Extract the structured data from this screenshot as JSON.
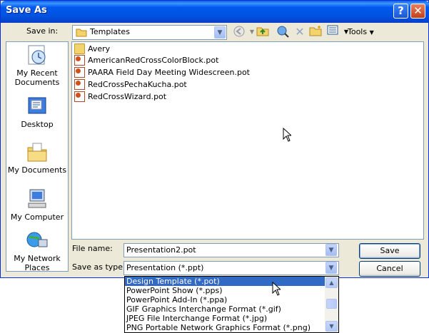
{
  "window": {
    "title": "Save As",
    "help_glyph": "?",
    "close_glyph": "✕"
  },
  "toolbar": {
    "save_in_label": "Save in:",
    "save_in_value": "Templates",
    "tools_label": "Tools",
    "icons": [
      "back-icon",
      "up-folder-icon",
      "search-web-icon",
      "delete-icon",
      "new-folder-icon",
      "views-icon"
    ]
  },
  "places": [
    {
      "id": "recent",
      "label": "My Recent Documents"
    },
    {
      "id": "desktop",
      "label": "Desktop"
    },
    {
      "id": "documents",
      "label": "My Documents"
    },
    {
      "id": "computer",
      "label": "My Computer"
    },
    {
      "id": "network",
      "label": "My Network Places"
    }
  ],
  "files": [
    {
      "name": "Avery",
      "kind": "folder"
    },
    {
      "name": "AmericanRedCrossColorBlock.pot",
      "kind": "pot"
    },
    {
      "name": "PAARA Field Day Meeting Widescreen.pot",
      "kind": "pot"
    },
    {
      "name": "RedCrossPechaKucha.pot",
      "kind": "pot"
    },
    {
      "name": "RedCrossWizard.pot",
      "kind": "pot"
    }
  ],
  "form": {
    "filename_label": "File name:",
    "filename_value": "Presentation2.pot",
    "savetype_label": "Save as type:",
    "savetype_value": "Presentation (*.ppt)",
    "save_button": "Save",
    "cancel_button": "Cancel"
  },
  "type_options": [
    {
      "label": "Design Template (*.pot)",
      "selected": true
    },
    {
      "label": "PowerPoint Show (*.pps)",
      "selected": false
    },
    {
      "label": "PowerPoint Add-In (*.ppa)",
      "selected": false
    },
    {
      "label": "GIF Graphics Interchange Format (*.gif)",
      "selected": false
    },
    {
      "label": "JPEG File Interchange Format (*.jpg)",
      "selected": false
    },
    {
      "label": "PNG Portable Network Graphics Format (*.png)",
      "selected": false
    }
  ],
  "colors": {
    "titlebar": "#0054e3",
    "selection": "#316ac5",
    "dialog_bg": "#ece9d8"
  }
}
